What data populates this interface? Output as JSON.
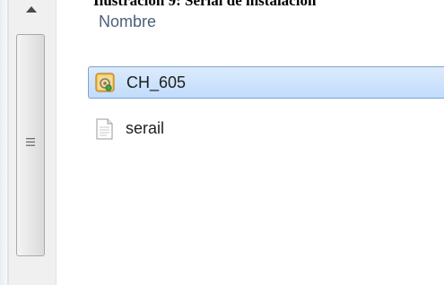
{
  "caption": {
    "text": "Ilustración 9: Serial de instalación"
  },
  "list": {
    "column_header": "Nombre",
    "items": [
      {
        "name": "CH_605",
        "icon": "setup-application-icon",
        "selected": true
      },
      {
        "name": "serail",
        "icon": "text-document-icon",
        "selected": false
      }
    ]
  },
  "scrollbar": {
    "up_icon": "scroll-up-arrow-icon",
    "grip_icon": "scroll-thumb-grip-icon"
  },
  "colors": {
    "selection_fill": "#c9e0fc",
    "selection_border": "#7da2ce",
    "header_text": "#4c607a"
  }
}
